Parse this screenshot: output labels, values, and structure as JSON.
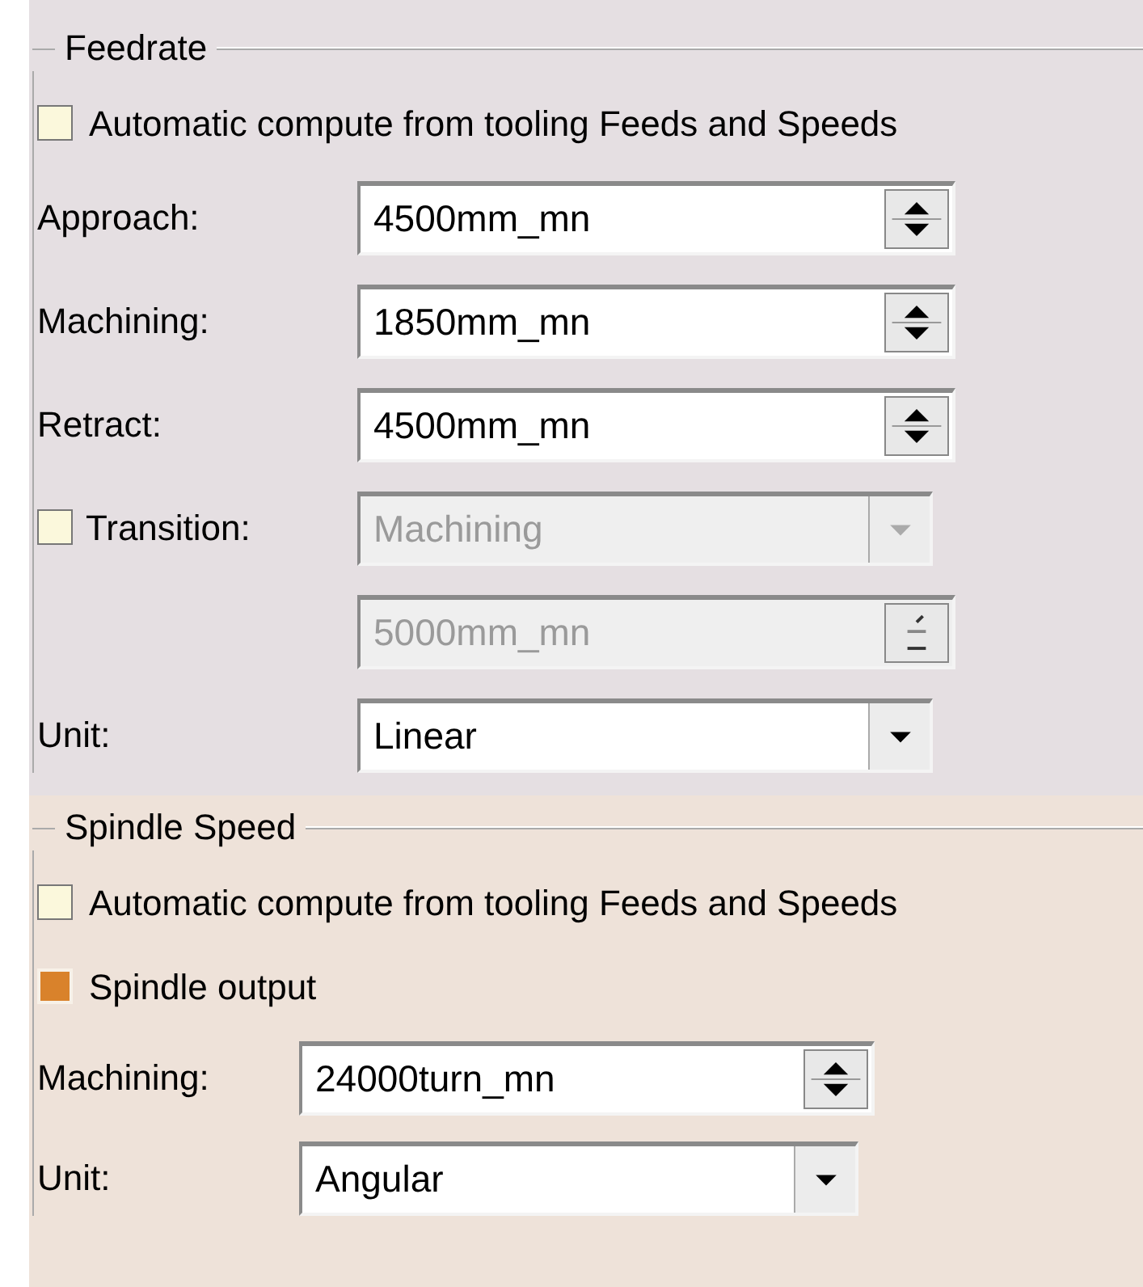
{
  "feedrate": {
    "legend": "Feedrate",
    "rows": [
      {
        "kind": "check",
        "label": "Automatic compute from tooling Feeds and Speeds",
        "checked": false
      },
      {
        "kind": "spin",
        "label": "Approach:",
        "value": "4500mm_mn",
        "disabled": false
      },
      {
        "kind": "spin",
        "label": "Machining:",
        "value": "1850mm_mn",
        "disabled": false
      },
      {
        "kind": "spin",
        "label": "Retract:",
        "value": "4500mm_mn",
        "disabled": false
      },
      {
        "kind": "combo",
        "label": "Transition:",
        "checked": false,
        "value": "Machining",
        "disabled": true
      },
      {
        "kind": "spin",
        "value": "5000mm_mn",
        "disabled": true
      },
      {
        "kind": "combo",
        "label": "Unit:",
        "value": "Linear",
        "disabled": false
      }
    ]
  },
  "spindle_speed": {
    "legend": "Spindle Speed",
    "rows": [
      {
        "kind": "check",
        "label": "Automatic compute from tooling Feeds and Speeds",
        "checked": false
      },
      {
        "kind": "check",
        "label": "Spindle output",
        "checked": true
      },
      {
        "kind": "spin",
        "label": "Machining:",
        "value": "24000turn_mn",
        "disabled": false
      },
      {
        "kind": "combo",
        "label": "Unit:",
        "value": "Angular",
        "disabled": false
      }
    ]
  }
}
